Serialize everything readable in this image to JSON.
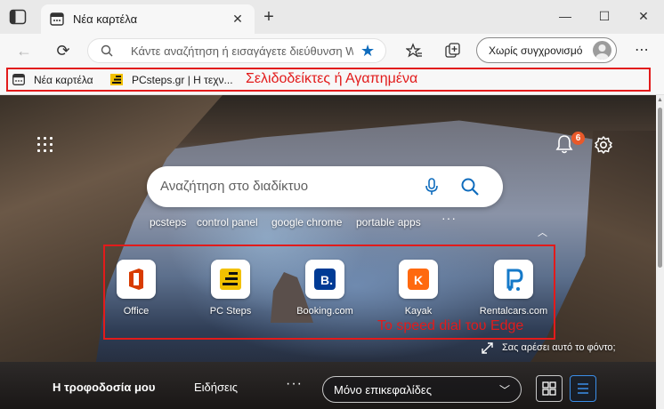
{
  "tab": {
    "title": "Νέα καρτέλα",
    "close": "✕"
  },
  "toolbar": {
    "new_tab": "+",
    "back": "←",
    "refresh": "⟳",
    "address_placeholder": "Κάντε αναζήτηση ή εισαγάγετε διεύθυνση Web",
    "star": "★",
    "profile_label": "Χωρίς συγχρονισμό",
    "menu": "⋯"
  },
  "window": {
    "minimize": "—",
    "maximize": "☐",
    "close": "✕"
  },
  "favorites": {
    "items": [
      {
        "label": "Νέα καρτέλα",
        "icon": "new-tab-icon"
      },
      {
        "label": "PCsteps.gr | Η τεχν...",
        "icon": "pcsteps-icon"
      }
    ],
    "annotation": "Σελιδοδείκτες ή Αγαπημένα"
  },
  "newtab": {
    "notification_count": "6",
    "search_placeholder": "Αναζήτηση στο διαδίκτυο",
    "suggestions": [
      "pcsteps",
      "control panel",
      "google chrome",
      "portable apps"
    ],
    "suggestions_more": "···",
    "tiles": [
      {
        "label": "Office",
        "icon": "office-icon"
      },
      {
        "label": "PC Steps",
        "icon": "pcsteps-icon"
      },
      {
        "label": "Booking.com",
        "icon": "booking-icon"
      },
      {
        "label": "Kayak",
        "icon": "kayak-icon"
      },
      {
        "label": "Rentalcars.com",
        "icon": "rentalcars-icon"
      }
    ],
    "speed_dial_annotation": "Το speed dial του Edge",
    "background_like": "Σας αρέσει αυτό το φόντο;",
    "bottom_nav": {
      "tabs": [
        "Η τροφοδοσία μου",
        "Ειδήσεις"
      ],
      "more": "···",
      "layout_select": "Μόνο επικεφαλίδες"
    }
  },
  "colors": {
    "annotation": "#e21b1b",
    "accent": "#0f6cbd",
    "badge": "#e8592a"
  }
}
